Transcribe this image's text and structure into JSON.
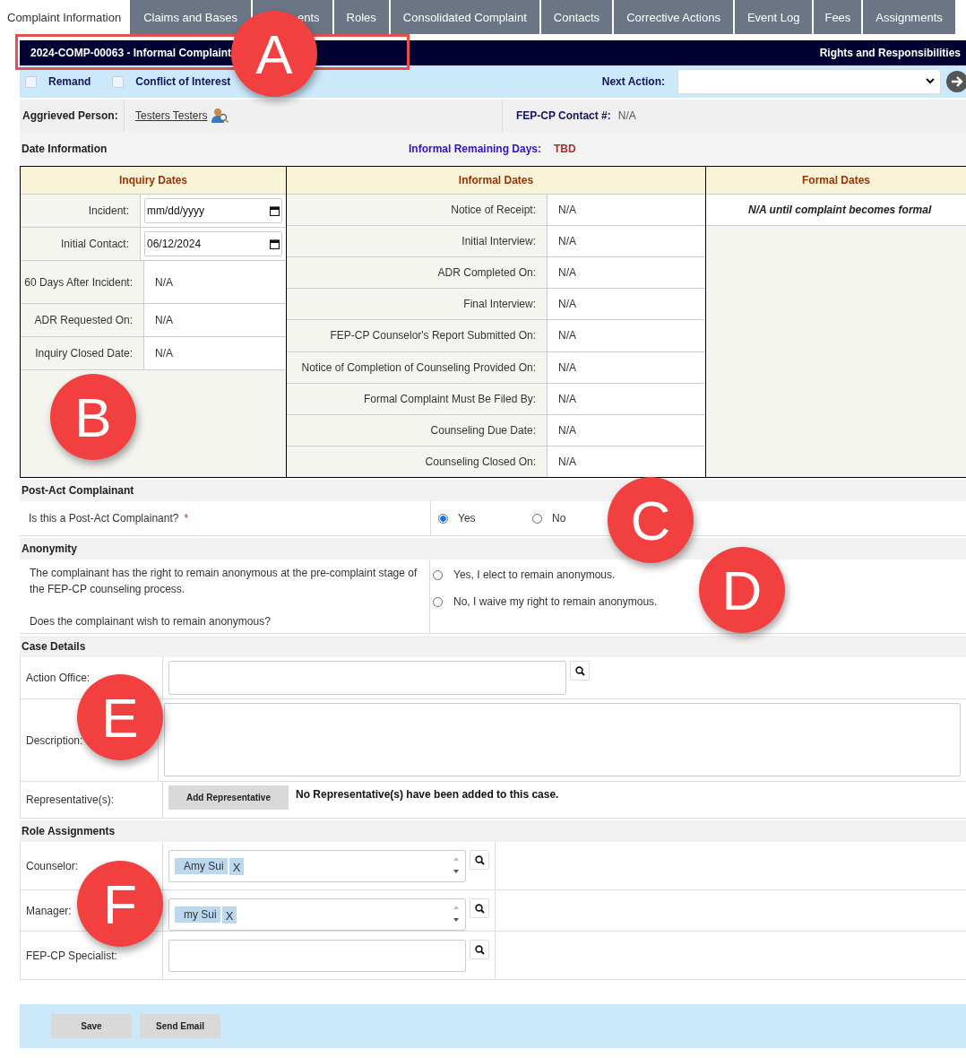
{
  "tabs": [
    {
      "label": "Complaint Information",
      "selected": true
    },
    {
      "label": "Claims and Bases",
      "selected": false
    },
    {
      "label": "ents",
      "selected": false
    },
    {
      "label": "Roles",
      "selected": false
    },
    {
      "label": "Consolidated Complaint",
      "selected": false
    },
    {
      "label": "Contacts",
      "selected": false
    },
    {
      "label": "Corrective Actions",
      "selected": false
    },
    {
      "label": "Event Log",
      "selected": false
    },
    {
      "label": "Fees",
      "selected": false
    },
    {
      "label": "Assignments",
      "selected": false
    }
  ],
  "header": {
    "title": "2024-COMP-00063 - Informal Complaint",
    "link": "Rights and Responsibilities"
  },
  "flags": [
    {
      "label": "Remand",
      "checked": false
    },
    {
      "label": "Conflict of Interest",
      "checked": false
    }
  ],
  "next_action": {
    "label": "Next Action:"
  },
  "aggrieved": {
    "label": "Aggrieved Person:",
    "value": "Testers Testers"
  },
  "contact": {
    "label": "FEP-CP Contact #:",
    "value": "N/A"
  },
  "date_info": {
    "title": "Date Information",
    "remaining_label": "Informal Remaining Days:",
    "remaining_value": "TBD"
  },
  "inquiry": {
    "title": "Inquiry Dates",
    "rows": [
      {
        "label": "Incident:",
        "kind": "date",
        "value": "mm/dd/yyyy"
      },
      {
        "label": "Initial Contact:",
        "kind": "date",
        "value": "06/12/2024"
      },
      {
        "label": "60 Days After Incident:",
        "kind": "text",
        "value": "N/A"
      },
      {
        "label": "ADR Requested On:",
        "kind": "text",
        "value": "N/A"
      },
      {
        "label": "Inquiry Closed Date:",
        "kind": "text",
        "value": "N/A"
      }
    ]
  },
  "informal": {
    "title": "Informal Dates",
    "rows": [
      {
        "label": "Notice of Receipt:",
        "value": "N/A"
      },
      {
        "label": "Initial Interview:",
        "value": "N/A"
      },
      {
        "label": "ADR Completed On:",
        "value": "N/A"
      },
      {
        "label": "Final Interview:",
        "value": "N/A"
      },
      {
        "label": "FEP-CP Counselor's Report Submitted On:",
        "value": "N/A"
      },
      {
        "label": "Notice of Completion of Counseling Provided On:",
        "value": "N/A"
      },
      {
        "label": "Formal Complaint Must Be Filed By:",
        "value": "N/A"
      },
      {
        "label": "Counseling Due Date:",
        "value": "N/A"
      },
      {
        "label": "Counseling Closed On:",
        "value": "N/A"
      }
    ]
  },
  "formal": {
    "title": "Formal Dates",
    "note": "N/A until complaint becomes formal"
  },
  "post_act": {
    "title": "Post-Act Complainant",
    "question": "Is this a Post-Act Complainant?",
    "required": "*",
    "options": [
      {
        "label": "Yes",
        "selected": true
      },
      {
        "label": "No",
        "selected": false
      }
    ]
  },
  "anonymity": {
    "title": "Anonymity",
    "text": "The complainant has the right to remain anonymous at the pre-complaint stage of the FEP-CP counseling process.",
    "question": "Does the complainant wish to remain anonymous?",
    "options": [
      {
        "label": "Yes, I elect to remain anonymous.",
        "selected": false
      },
      {
        "label": "No, I waive my right to remain anonymous.",
        "selected": false
      }
    ]
  },
  "case_details": {
    "title": "Case Details",
    "action_office": "Action Office:",
    "description": "Description:",
    "representatives": {
      "label": "Representative(s):",
      "button": "Add Representative",
      "note": "No Representative(s) have been added to this case."
    }
  },
  "roles": {
    "title": "Role Assignments",
    "rows": [
      {
        "label": "Counselor:",
        "kind": "multi",
        "chips": [
          {
            "name": "Amy Sui",
            "remove": "X"
          }
        ]
      },
      {
        "label": "Manager:",
        "kind": "multi",
        "chips": [
          {
            "name": "my Sui",
            "remove": "X"
          }
        ]
      },
      {
        "label": "FEP-CP Specialist:",
        "kind": "single"
      }
    ]
  },
  "buttons": [
    "Save",
    "Send Email"
  ],
  "callouts": [
    "A",
    "B",
    "C",
    "D",
    "E",
    "F"
  ]
}
